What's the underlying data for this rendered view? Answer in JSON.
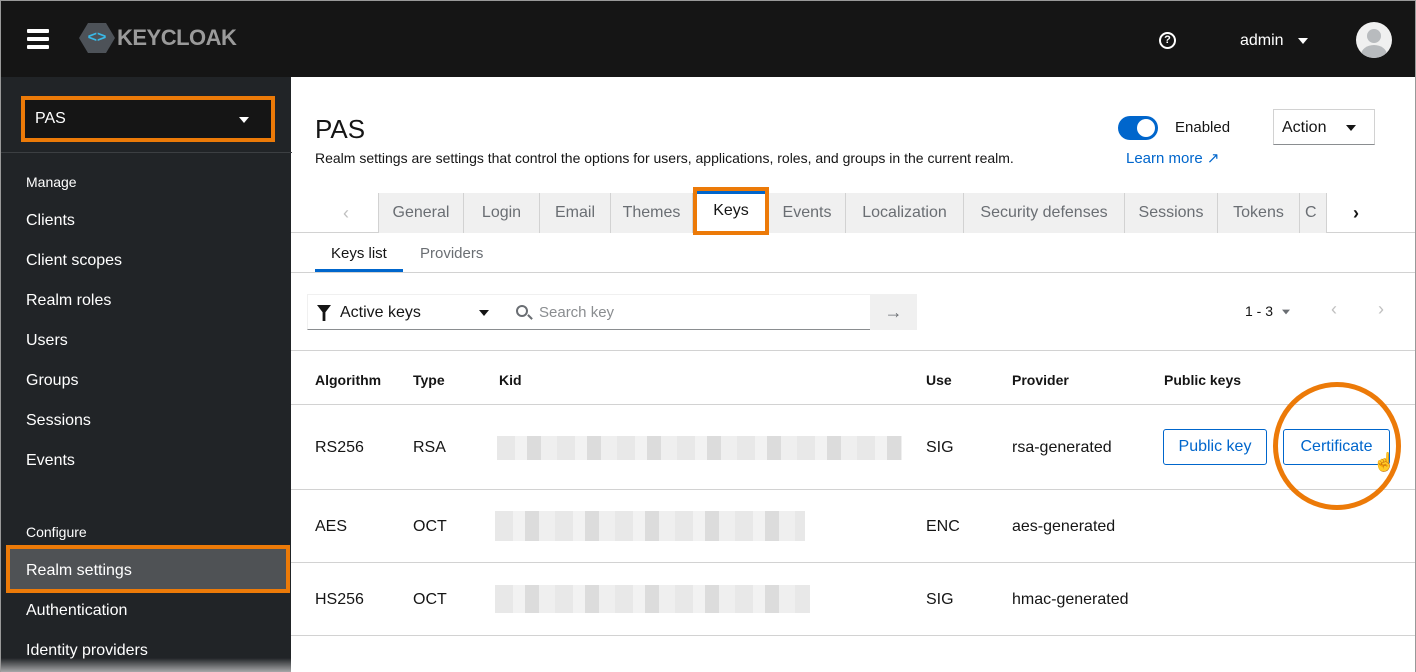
{
  "header": {
    "logo_text": "KEYCLOAK",
    "user": "admin"
  },
  "sidebar": {
    "realm": "PAS",
    "manage_label": "Manage",
    "manage_items": [
      "Clients",
      "Client scopes",
      "Realm roles",
      "Users",
      "Groups",
      "Sessions",
      "Events"
    ],
    "configure_label": "Configure",
    "configure_items": [
      "Realm settings",
      "Authentication",
      "Identity providers"
    ]
  },
  "page": {
    "title": "PAS",
    "description": "Realm settings are settings that control the options for users, applications, roles, and groups in the current realm.",
    "learn_more": "Learn more",
    "enabled_label": "Enabled",
    "enabled": true,
    "action_label": "Action"
  },
  "tabs": [
    "General",
    "Login",
    "Email",
    "Themes",
    "Keys",
    "Events",
    "Localization",
    "Security defenses",
    "Sessions",
    "Tokens",
    "C"
  ],
  "subtabs": [
    "Keys list",
    "Providers"
  ],
  "toolbar": {
    "filter": "Active keys",
    "search_placeholder": "Search key",
    "pagination": "1 - 3"
  },
  "table": {
    "headers": [
      "Algorithm",
      "Type",
      "Kid",
      "Use",
      "Provider",
      "Public keys"
    ],
    "rows": [
      {
        "algorithm": "RS256",
        "type": "RSA",
        "use": "SIG",
        "provider": "rsa-generated",
        "public_key": "Public key",
        "certificate": "Certificate"
      },
      {
        "algorithm": "AES",
        "type": "OCT",
        "use": "ENC",
        "provider": "aes-generated"
      },
      {
        "algorithm": "HS256",
        "type": "OCT",
        "use": "SIG",
        "provider": "hmac-generated"
      }
    ]
  },
  "colors": {
    "highlight": "#ec7a08",
    "accent": "#0066cc"
  }
}
